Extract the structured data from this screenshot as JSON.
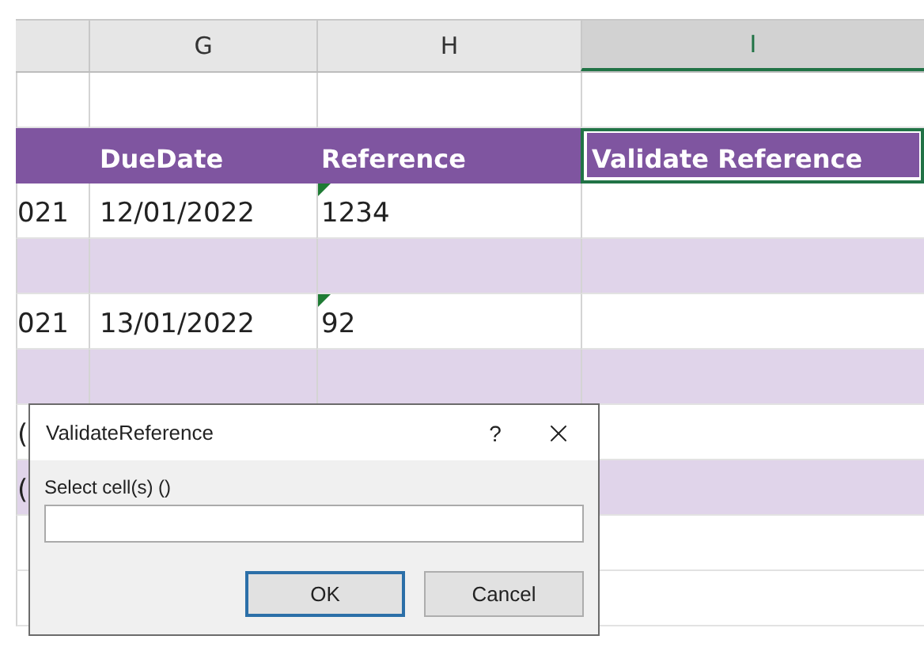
{
  "column_headers": [
    {
      "label": "G",
      "selected": false
    },
    {
      "label": "H",
      "selected": false
    },
    {
      "label": "I",
      "selected": true
    }
  ],
  "rows": [
    {
      "kind": "blank",
      "shaded": false,
      "i_selected": false
    },
    {
      "kind": "header",
      "column_g": "DueDate",
      "column_h": "Reference",
      "column_i": "Validate Reference",
      "i_selected": true
    },
    {
      "kind": "data",
      "shaded": false,
      "column_f": "021",
      "column_g": "12/01/2022",
      "column_h": "1234",
      "h_flag": true,
      "i_selected": false
    },
    {
      "kind": "data",
      "shaded": true,
      "i_selected": false
    },
    {
      "kind": "data",
      "shaded": false,
      "column_f": "021",
      "column_g": "13/01/2022",
      "column_h": "92",
      "h_flag": true,
      "i_selected": false
    },
    {
      "kind": "data",
      "shaded": true,
      "i_selected": false
    },
    {
      "kind": "data",
      "shaded": false,
      "column_f": "(",
      "i_selected": false
    },
    {
      "kind": "data",
      "shaded": true,
      "column_f": "(",
      "i_selected": false
    },
    {
      "kind": "data",
      "shaded": false,
      "i_selected": false
    },
    {
      "kind": "data",
      "shaded": false,
      "i_selected": false
    }
  ],
  "dialog": {
    "title": "ValidateReference",
    "help": "?",
    "label": "Select cell(s) ()",
    "buttons": [
      {
        "label": "OK",
        "default": true
      },
      {
        "label": "Cancel",
        "default": false
      }
    ]
  }
}
